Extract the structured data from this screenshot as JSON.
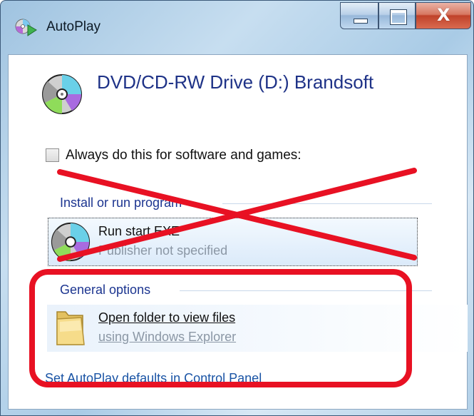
{
  "window": {
    "title": "AutoPlay",
    "title_icon": "autoplay-icon",
    "controls": {
      "minimize_icon": "minimize-icon",
      "maximize_icon": "maximize-icon",
      "close_label": "X"
    }
  },
  "device": {
    "title": "DVD/CD-RW Drive (D:) Brandsoft",
    "icon": "disc-icon"
  },
  "always": {
    "label": "Always do this for software and games:",
    "checked": false
  },
  "install_section": {
    "title": "Install or run program",
    "items": [
      {
        "icon": "disc-icon",
        "title": "Run start.EXE",
        "subtitle": "Publisher not specified"
      }
    ]
  },
  "general_section": {
    "title": "General options",
    "items": [
      {
        "icon": "folder-icon",
        "title": "Open folder to view files",
        "subtitle": "using Windows Explorer"
      }
    ]
  },
  "footer": {
    "link": "Set AutoPlay defaults in Control Panel"
  },
  "annotations": {
    "cross_color": "#e81123",
    "highlight_color": "#e81123"
  }
}
